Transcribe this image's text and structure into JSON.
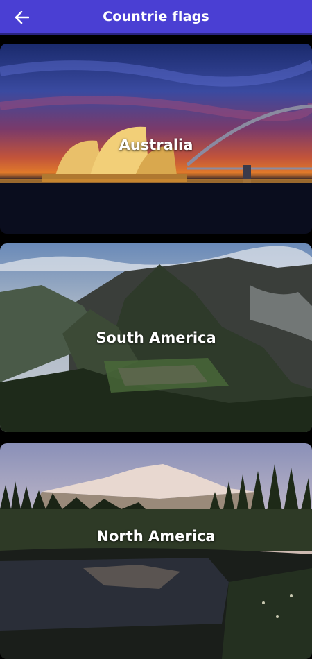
{
  "appbar": {
    "title": "Countrie flags",
    "back_icon": "arrow-left-icon",
    "background": "#4a3fd3"
  },
  "regions": [
    {
      "label": "Australia"
    },
    {
      "label": "South America"
    },
    {
      "label": "North America"
    }
  ]
}
